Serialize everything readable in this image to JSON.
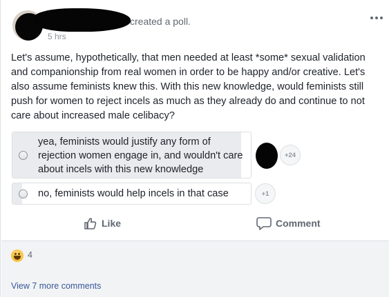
{
  "header": {
    "action_text": "created a poll.",
    "timestamp": "5 hrs"
  },
  "post": {
    "text": "Let's assume, hypothetically, that men needed at least *some* sexual validation and companionship from real women in order to be happy and/or creative. Let's also assume feminists knew this. With this new knowledge, would feminists still push for women to reject incels as much as they already do and continue to not care about increased male celibacy?"
  },
  "poll": {
    "options": [
      {
        "label": "yea, feminists would justify any form of rejection women engage in, and wouldn't care about incels with this new knowledge",
        "badge": "+24",
        "vote_share": 0.96
      },
      {
        "label": "no, feminists would help incels in that case",
        "badge": "+1",
        "vote_share": 0.04
      }
    ]
  },
  "actions": {
    "like_label": "Like",
    "comment_label": "Comment"
  },
  "footer": {
    "reaction_count": "4",
    "view_more_label": "View 7 more comments"
  },
  "colors": {
    "link": "#385898",
    "muted": "#606770",
    "poll_fill": "#e9ebee",
    "footer_bg": "#f2f3f5"
  }
}
